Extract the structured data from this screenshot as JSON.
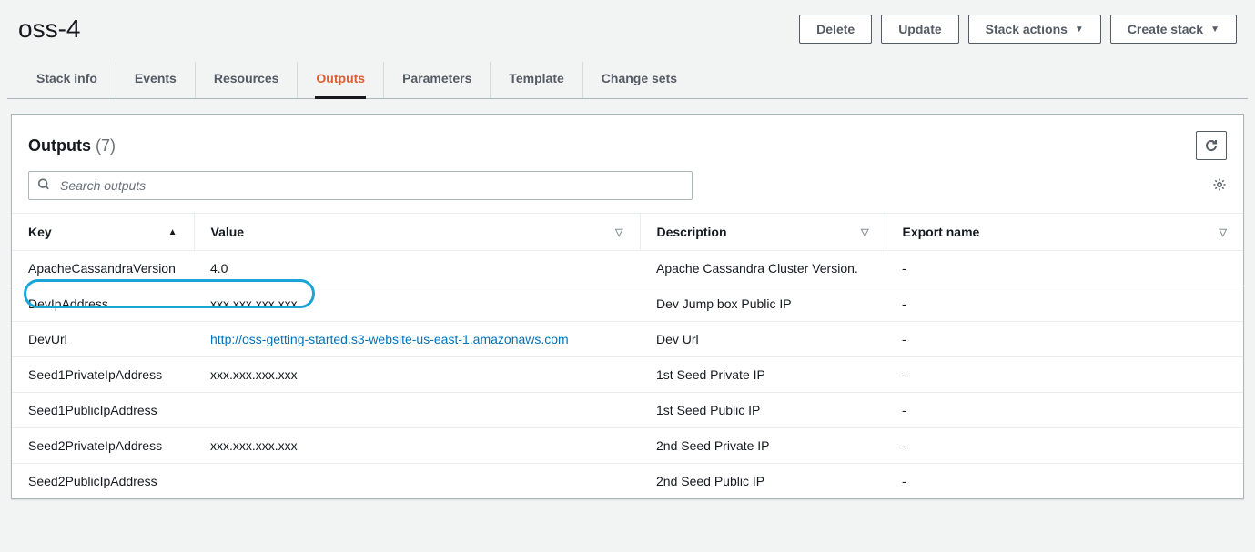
{
  "header": {
    "title": "oss-4",
    "buttons": {
      "delete": "Delete",
      "update": "Update",
      "stack_actions": "Stack actions",
      "create_stack": "Create stack"
    }
  },
  "tabs": [
    {
      "label": "Stack info"
    },
    {
      "label": "Events"
    },
    {
      "label": "Resources"
    },
    {
      "label": "Outputs"
    },
    {
      "label": "Parameters"
    },
    {
      "label": "Template"
    },
    {
      "label": "Change sets"
    }
  ],
  "panel": {
    "title": "Outputs",
    "count": "(7)",
    "search_placeholder": "Search outputs"
  },
  "columns": {
    "key": "Key",
    "value": "Value",
    "description": "Description",
    "export_name": "Export name"
  },
  "rows": [
    {
      "key": "ApacheCassandraVersion",
      "value": "4.0",
      "link": false,
      "description": "Apache Cassandra Cluster Version.",
      "export_name": "-"
    },
    {
      "key": "DevIpAddress",
      "value": "xxx.xxx.xxx.xxx",
      "link": false,
      "description": "Dev Jump box Public IP",
      "export_name": "-"
    },
    {
      "key": "DevUrl",
      "value": "http://oss-getting-started.s3-website-us-east-1.amazonaws.com",
      "link": true,
      "description": "Dev Url",
      "export_name": "-"
    },
    {
      "key": "Seed1PrivateIpAddress",
      "value": "xxx.xxx.xxx.xxx",
      "link": false,
      "description": "1st Seed Private IP",
      "export_name": "-"
    },
    {
      "key": "Seed1PublicIpAddress",
      "value": "",
      "link": false,
      "description": "1st Seed Public IP",
      "export_name": "-"
    },
    {
      "key": "Seed2PrivateIpAddress",
      "value": "xxx.xxx.xxx.xxx",
      "link": false,
      "description": "2nd Seed Private IP",
      "export_name": "-"
    },
    {
      "key": "Seed2PublicIpAddress",
      "value": "",
      "link": false,
      "description": "2nd Seed Public IP",
      "export_name": "-"
    }
  ]
}
